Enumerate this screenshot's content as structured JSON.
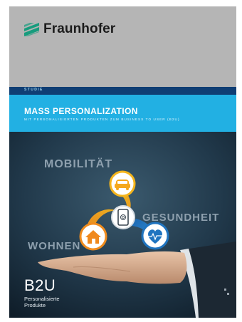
{
  "brand": {
    "name": "Fraunhofer"
  },
  "series_label": "STUDIE",
  "title": "MASS PERSONALIZATION",
  "subtitle": "MIT PERSONALISIERTEN PRODUKTEN ZUM BUSINESS TO USER (B2U)",
  "keywords": {
    "mobility": "MOBILITÄT",
    "health": "GESUNDHEIT",
    "living": "WOHNEN"
  },
  "icons": [
    "car-icon",
    "smartphone-fingerprint-icon",
    "house-icon",
    "heart-pulse-icon"
  ],
  "footer": {
    "heading": "B2U",
    "line1": "Personalisierte",
    "line2": "Produkte"
  },
  "colors": {
    "band_dark": "#0f3e74",
    "band_light": "#22b0e3",
    "car_ring": "#f5b51c",
    "house_ring": "#f08c1e",
    "heart_ring": "#1f74c0"
  }
}
